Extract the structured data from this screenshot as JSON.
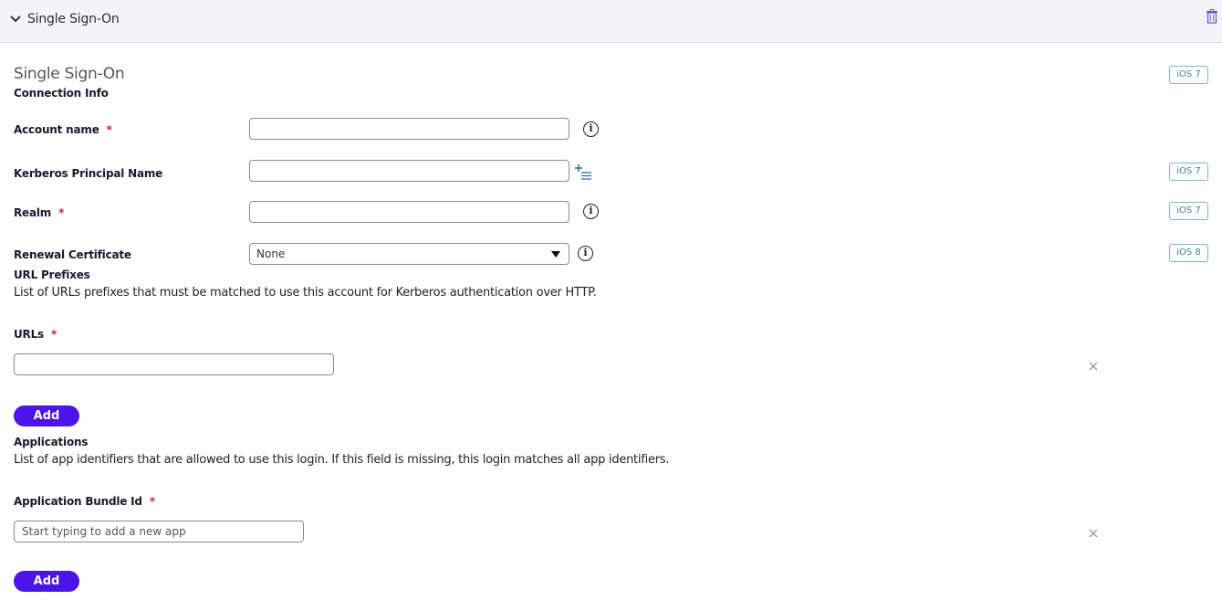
{
  "header": {
    "title": "Single Sign-On",
    "icons": [
      "chevron-down-icon",
      "trash-icon"
    ]
  },
  "section": {
    "title": "Single Sign-On",
    "subtitle": "Connection Info",
    "badge": "iOS 7"
  },
  "fields": {
    "account_name": {
      "label": "Account name",
      "required": "*",
      "value": ""
    },
    "kerberos": {
      "label": "Kerberos Principal Name",
      "value": "",
      "badge": "iOS 7"
    },
    "realm": {
      "label": "Realm",
      "required": "*",
      "value": "",
      "badge": "iOS 7"
    },
    "renewal": {
      "label": "Renewal Certificate",
      "selected": "None",
      "badge": "iOS 8"
    }
  },
  "url_prefixes": {
    "title": "URL Prefixes",
    "description": "List of URLs prefixes that must be matched to use this account for Kerberos authentication over HTTP.",
    "label": "URLs",
    "required": "*",
    "value": "",
    "add_label": "Add"
  },
  "applications": {
    "title": "Applications",
    "description": "List of app identifiers that are allowed to use this login. If this field is missing, this login matches all app identifiers.",
    "label": "Application Bundle Id",
    "required": "*",
    "placeholder": "Start typing to add a new app",
    "add_label": "Add"
  },
  "colors": {
    "accent": "#4c14e8",
    "required": "#c0263a",
    "badge_border": "#7fb7c4",
    "badge_text": "#4b7f8c",
    "header_bg": "#f3f3f8"
  }
}
